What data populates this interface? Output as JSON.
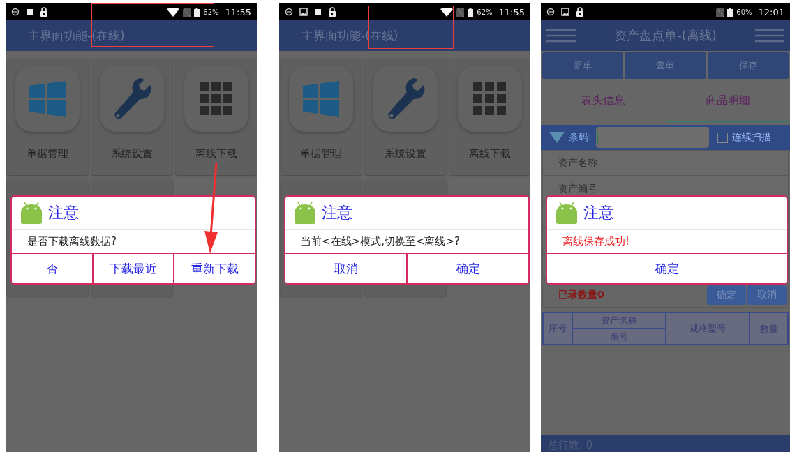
{
  "screens": [
    {
      "kind": "menu",
      "status_bar": {
        "battery": "62%",
        "time": "11:55"
      },
      "title": "主界面功能-(在线)",
      "tiles": [
        {
          "label": "单据管理"
        },
        {
          "label": "系统设置"
        },
        {
          "label": "离线下载"
        }
      ],
      "dialog": {
        "title": "注意",
        "message": "是否下载离线数据?",
        "error": false,
        "buttons": [
          "否",
          "下载最近",
          "重新下载"
        ]
      }
    },
    {
      "kind": "menu",
      "status_bar": {
        "battery": "62%",
        "time": "11:55"
      },
      "title": "主界面功能-(在线)",
      "tiles": [
        {
          "label": "单据管理"
        },
        {
          "label": "系统设置"
        },
        {
          "label": "离线下载"
        }
      ],
      "dialog": {
        "title": "注意",
        "message": "当前<在线>模式,切换至<离线>?",
        "error": false,
        "buttons": [
          "取消",
          "确定"
        ]
      }
    },
    {
      "kind": "form",
      "status_bar": {
        "battery": "60%",
        "time": "12:01"
      },
      "title": "资产盘点单-(离线)",
      "toolbar": [
        "新单",
        "查单",
        "保存"
      ],
      "tabs": [
        {
          "label": "表头信息",
          "selected": false
        },
        {
          "label": "商品明细",
          "selected": true
        }
      ],
      "barcode": {
        "label": "条码:",
        "continuous_scan": {
          "label": "连续扫描",
          "checked": false
        }
      },
      "form_rows": [
        "资产名称",
        "资产编号"
      ],
      "dialog": {
        "title": "注意",
        "message": "离线保存成功!",
        "error": true,
        "buttons": [
          "确定"
        ]
      },
      "count_label": "已录数量0",
      "count_buttons": [
        "确定",
        "取消"
      ],
      "table_columns": [
        {
          "label": "序号"
        },
        {
          "label": "资产名称",
          "sub_label": "编号"
        },
        {
          "label": "规格型号"
        },
        {
          "label": "数量"
        }
      ],
      "footer": "总行数: 0"
    }
  ]
}
